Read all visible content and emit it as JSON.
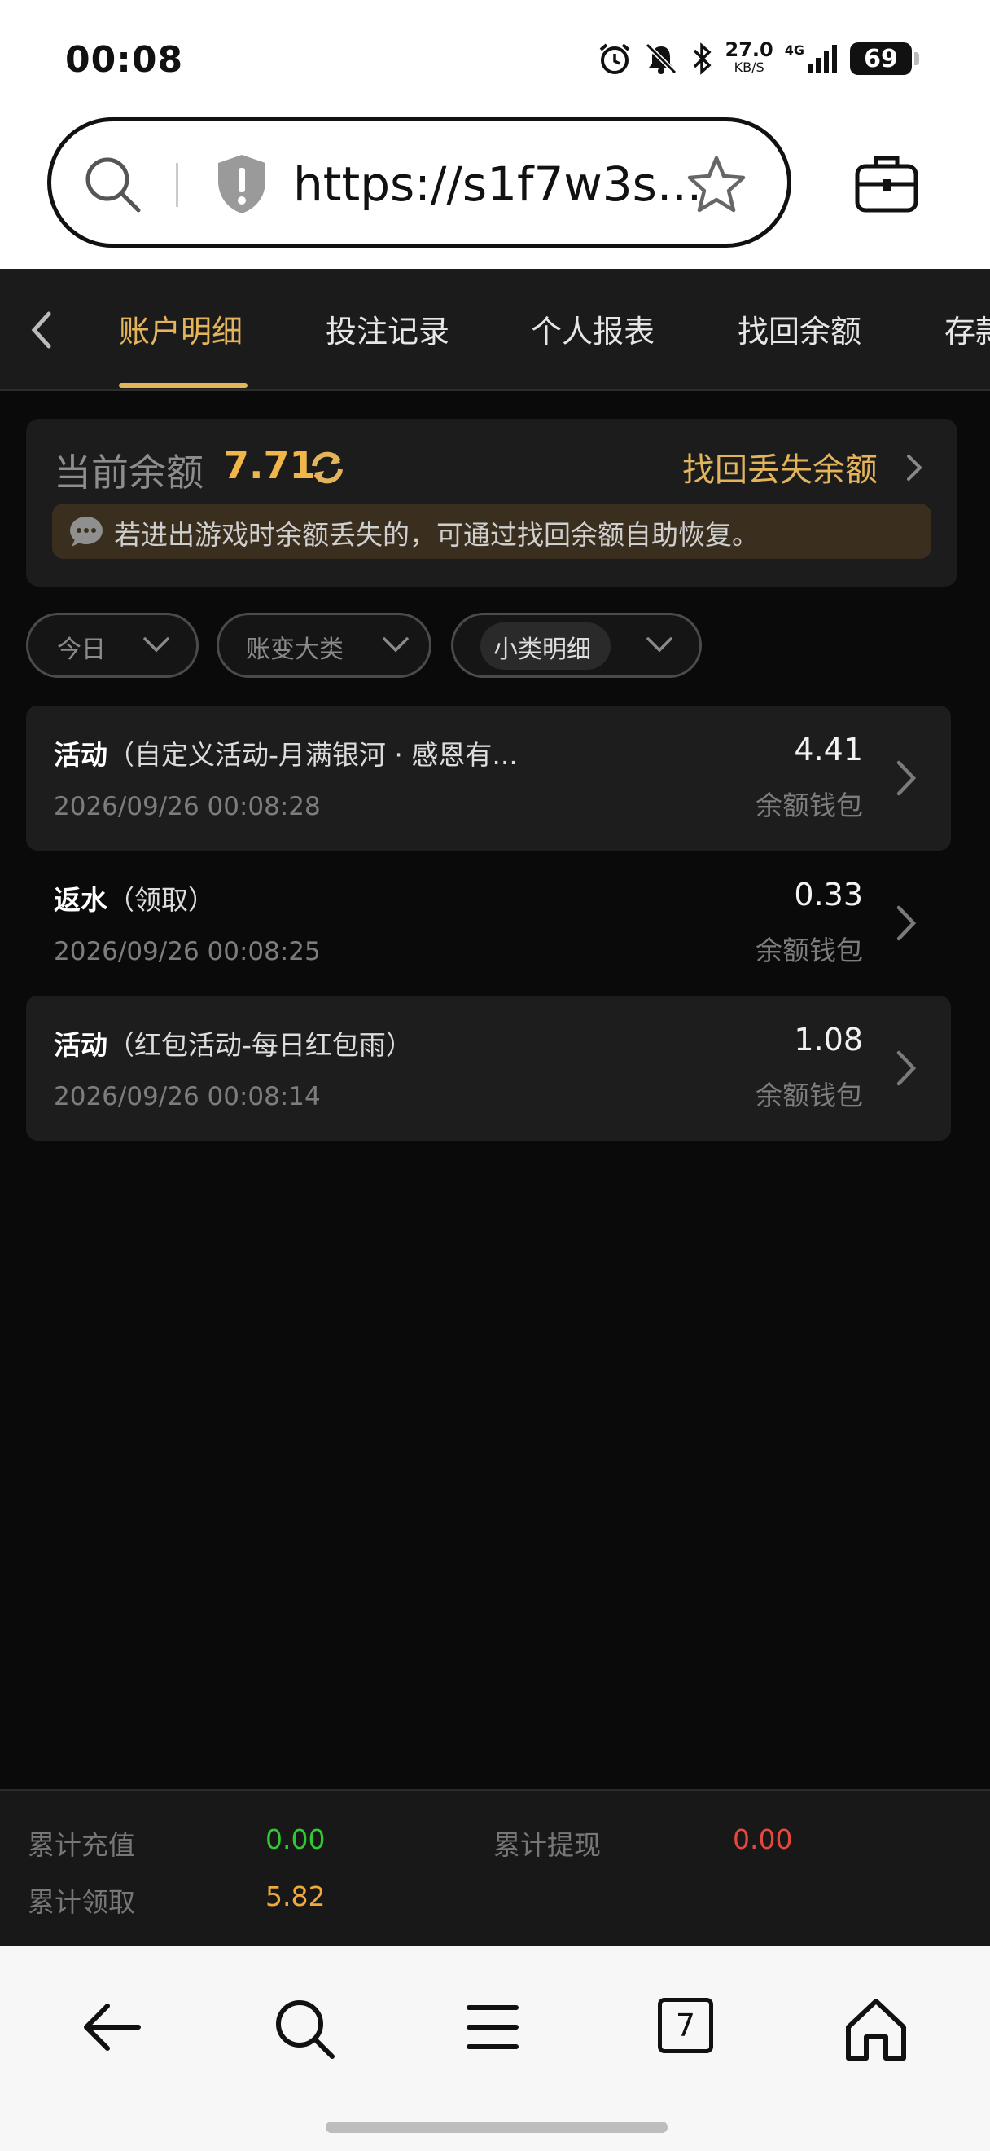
{
  "status_bar": {
    "time": "00:08",
    "net_speed": "27.0",
    "net_unit": "KB/S",
    "signal": "4G",
    "battery": "69"
  },
  "browser": {
    "url": "https://s1f7w3s..."
  },
  "tabs": [
    {
      "label": "账户明细",
      "active": true
    },
    {
      "label": "投注记录",
      "active": false
    },
    {
      "label": "个人报表",
      "active": false
    },
    {
      "label": "找回余额",
      "active": false
    },
    {
      "label": "存款",
      "active": false
    }
  ],
  "balance": {
    "label": "当前余额",
    "value": "7.71",
    "recover_link": "找回丢失余额",
    "notice": "若进出游戏时余额丢失的，可通过找回余额自助恢复。"
  },
  "filters": [
    {
      "label": "今日"
    },
    {
      "label": "账变大类"
    },
    {
      "label": "小类明细"
    }
  ],
  "records": [
    {
      "type": "活动",
      "detail": "（自定义活动-月满银河 · 感恩有...",
      "time": "2026/09/26 00:08:28",
      "amount": "4.41",
      "wallet": "余额钱包"
    },
    {
      "type": "返水",
      "detail": "（领取）",
      "time": "2026/09/26 00:08:25",
      "amount": "0.33",
      "wallet": "余额钱包"
    },
    {
      "type": "活动",
      "detail": "（红包活动-每日红包雨）",
      "time": "2026/09/26 00:08:14",
      "amount": "1.08",
      "wallet": "余额钱包"
    }
  ],
  "totals": {
    "recharge_label": "累计充值",
    "recharge_value": "0.00",
    "withdraw_label": "累计提现",
    "withdraw_value": "0.00",
    "claim_label": "累计领取",
    "claim_value": "5.82"
  },
  "bottom_nav": {
    "tab_count": "7"
  },
  "colors": {
    "accent_gold": "#e3b45a",
    "recharge_green": "#32c832",
    "withdraw_red": "#e5483f",
    "claim_orange": "#f0a93a"
  }
}
